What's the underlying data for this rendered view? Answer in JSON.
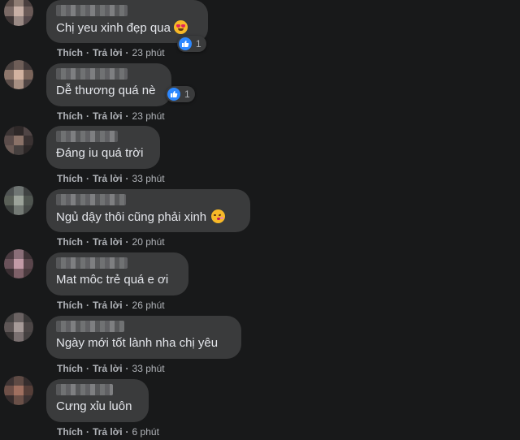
{
  "comments": [
    {
      "text": "Chị yeu xinh đẹp qua",
      "emoji": "heart-eyes-emoji",
      "reaction_count": "1",
      "like_label": "Thích",
      "reply_label": "Trả lời",
      "time": "23 phút"
    },
    {
      "text": "Dễ thương quá nè",
      "reaction_count": "1",
      "like_label": "Thích",
      "reply_label": "Trả lời",
      "time": "23 phút"
    },
    {
      "text": "Đáng iu quá trời",
      "like_label": "Thích",
      "reply_label": "Trả lời",
      "time": "33 phút"
    },
    {
      "text": "Ngủ dậy thôi cũng phải xinh",
      "emoji": "kissing-emoji",
      "like_label": "Thích",
      "reply_label": "Trả lời",
      "time": "20 phút"
    },
    {
      "text": "Mat môc trẻ quá e ơi",
      "like_label": "Thích",
      "reply_label": "Trả lời",
      "time": "26 phút"
    },
    {
      "text": "Ngày mới tốt lành nha chị yêu",
      "like_label": "Thích",
      "reply_label": "Trả lời",
      "time": "33 phút"
    },
    {
      "text": "Cưng xỉu luôn",
      "like_label": "Thích",
      "reply_label": "Trả lời",
      "time": "6 phút"
    }
  ],
  "colors": {
    "background": "#18191a",
    "bubble": "#3a3b3c",
    "text": "#e4e6eb",
    "secondary_text": "#b0b3b8",
    "like_blue": "#2d88ff"
  }
}
